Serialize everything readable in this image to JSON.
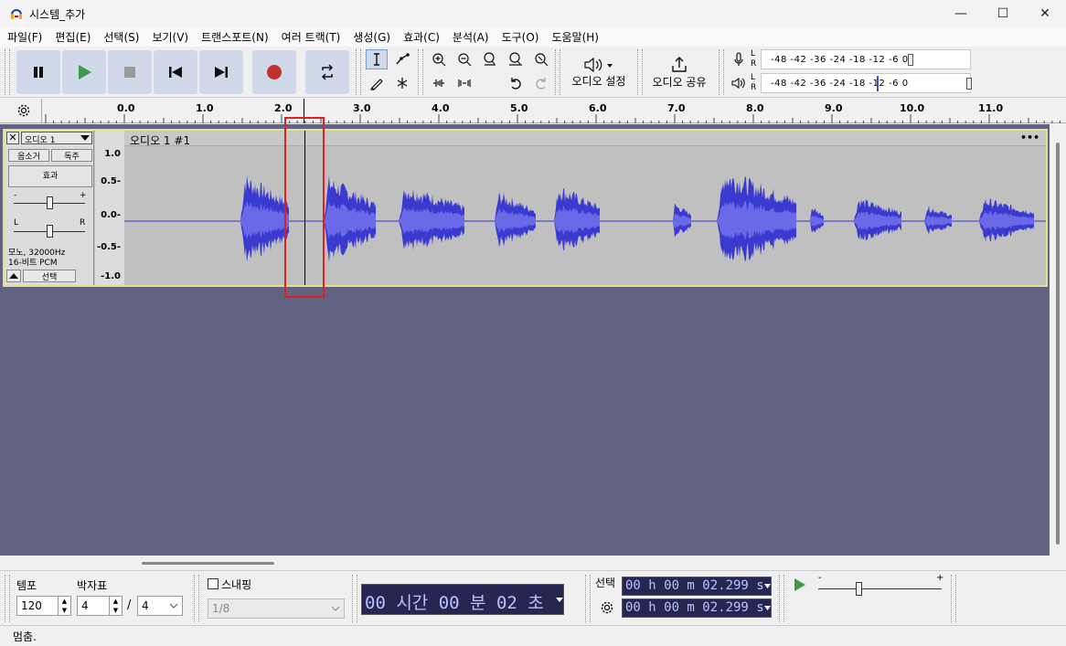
{
  "window": {
    "title": "시스템_추가"
  },
  "menu": [
    "파일(F)",
    "편집(E)",
    "선택(S)",
    "보기(V)",
    "트랜스포트(N)",
    "여러 트랙(T)",
    "생성(G)",
    "효과(C)",
    "분석(A)",
    "도구(O)",
    "도움말(H)"
  ],
  "toolbar": {
    "audio_settings_label": "오디오 설정",
    "share_audio_label": "오디오 공유",
    "meter_scale": "-48  -42  -36      -24  -18  -12   -6   0",
    "meter_lr": [
      "L",
      "R"
    ]
  },
  "ruler": {
    "labels": [
      "0.0",
      "1.0",
      "2.0",
      "3.0",
      "4.0",
      "5.0",
      "6.0",
      "7.0",
      "8.0",
      "9.0",
      "10.0",
      "11.0"
    ]
  },
  "track": {
    "name": "오디오 1",
    "clip_name": "오디오 1 #1",
    "mute_label": "음소거",
    "solo_label": "독주",
    "effects_label": "효과",
    "gain_minus": "-",
    "gain_plus": "+",
    "pan_left": "L",
    "pan_right": "R",
    "info_line1": "모노, 32000Hz",
    "info_line2": "16-비트 PCM",
    "select_label": "선택",
    "scale": [
      "1.0",
      "0.5-",
      "0.0-",
      "-0.5-",
      "-1.0"
    ],
    "more": "•••"
  },
  "bottom": {
    "tempo_label": "템포",
    "tempo_value": "120",
    "timesig_label": "박자표",
    "timesig_num": "4",
    "timesig_sep": "/",
    "timesig_den": "4",
    "snap_label": "스내핑",
    "snap_value": "1/8",
    "time_display": "00 시간 00 분 02 초",
    "selection_label": "선택",
    "sel_start": "00 h 00 m 02.299 s",
    "sel_end": "00 h 00 m 02.299 s",
    "play_speed_minus": "-",
    "play_speed_plus": "+"
  },
  "status": {
    "text": "멈춤."
  }
}
